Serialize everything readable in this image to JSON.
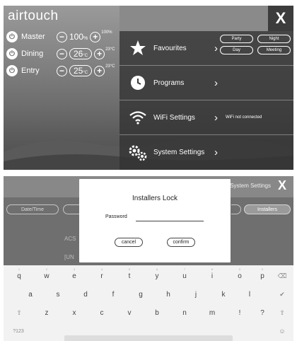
{
  "app": {
    "logo_text": "airtouch"
  },
  "zones": [
    {
      "name": "Master",
      "value": "100",
      "unit": "%",
      "max": "100%",
      "boxed": false
    },
    {
      "name": "Dining",
      "value": "26",
      "unit": "°C",
      "max": "23°C",
      "boxed": true
    },
    {
      "name": "Entry",
      "value": "25",
      "unit": "°C",
      "max": "23°C",
      "boxed": true
    }
  ],
  "menu": {
    "close_label": "X",
    "items": [
      {
        "label": "Favourites",
        "icon": "star-icon"
      },
      {
        "label": "Programs",
        "icon": "clock-icon"
      },
      {
        "label": "WiFi Settings",
        "icon": "wifi-icon",
        "status": "WiFi not connected"
      },
      {
        "label": "System Settings",
        "icon": "gears-icon"
      }
    ],
    "favourites": [
      "Party",
      "Night",
      "Day",
      "Meeting"
    ]
  },
  "system_settings": {
    "title": "System Settings",
    "close_label": "X",
    "tabs": [
      "Date/Time",
      "Installers"
    ],
    "faded_text": [
      "ACS",
      "[UN"
    ]
  },
  "dialog": {
    "title": "Installers Lock",
    "password_label": "Password",
    "cancel_label": "cancel",
    "confirm_label": "confirm"
  },
  "keyboard": {
    "row1": [
      "q",
      "w",
      "e",
      "r",
      "t",
      "y",
      "u",
      "i",
      "o",
      "p"
    ],
    "row1_hints": [
      "1",
      "2",
      "3",
      "4",
      "5",
      "6",
      "7",
      "8",
      "9",
      "0"
    ],
    "row2": [
      "a",
      "s",
      "d",
      "f",
      "g",
      "h",
      "j",
      "k",
      "l"
    ],
    "row3": [
      "z",
      "x",
      "c",
      "v",
      "b",
      "n",
      "m",
      "!",
      "?"
    ],
    "shift_glyph": "⇧",
    "backspace_glyph": "⌫",
    "enter_glyph": "✔",
    "symbols_label": "?123",
    "emoji_glyph": "☺"
  },
  "colors": {
    "panel_dark": "#323232",
    "dialog_bg": "#ffffff",
    "keyboard_bg": "#f2f2f2"
  }
}
